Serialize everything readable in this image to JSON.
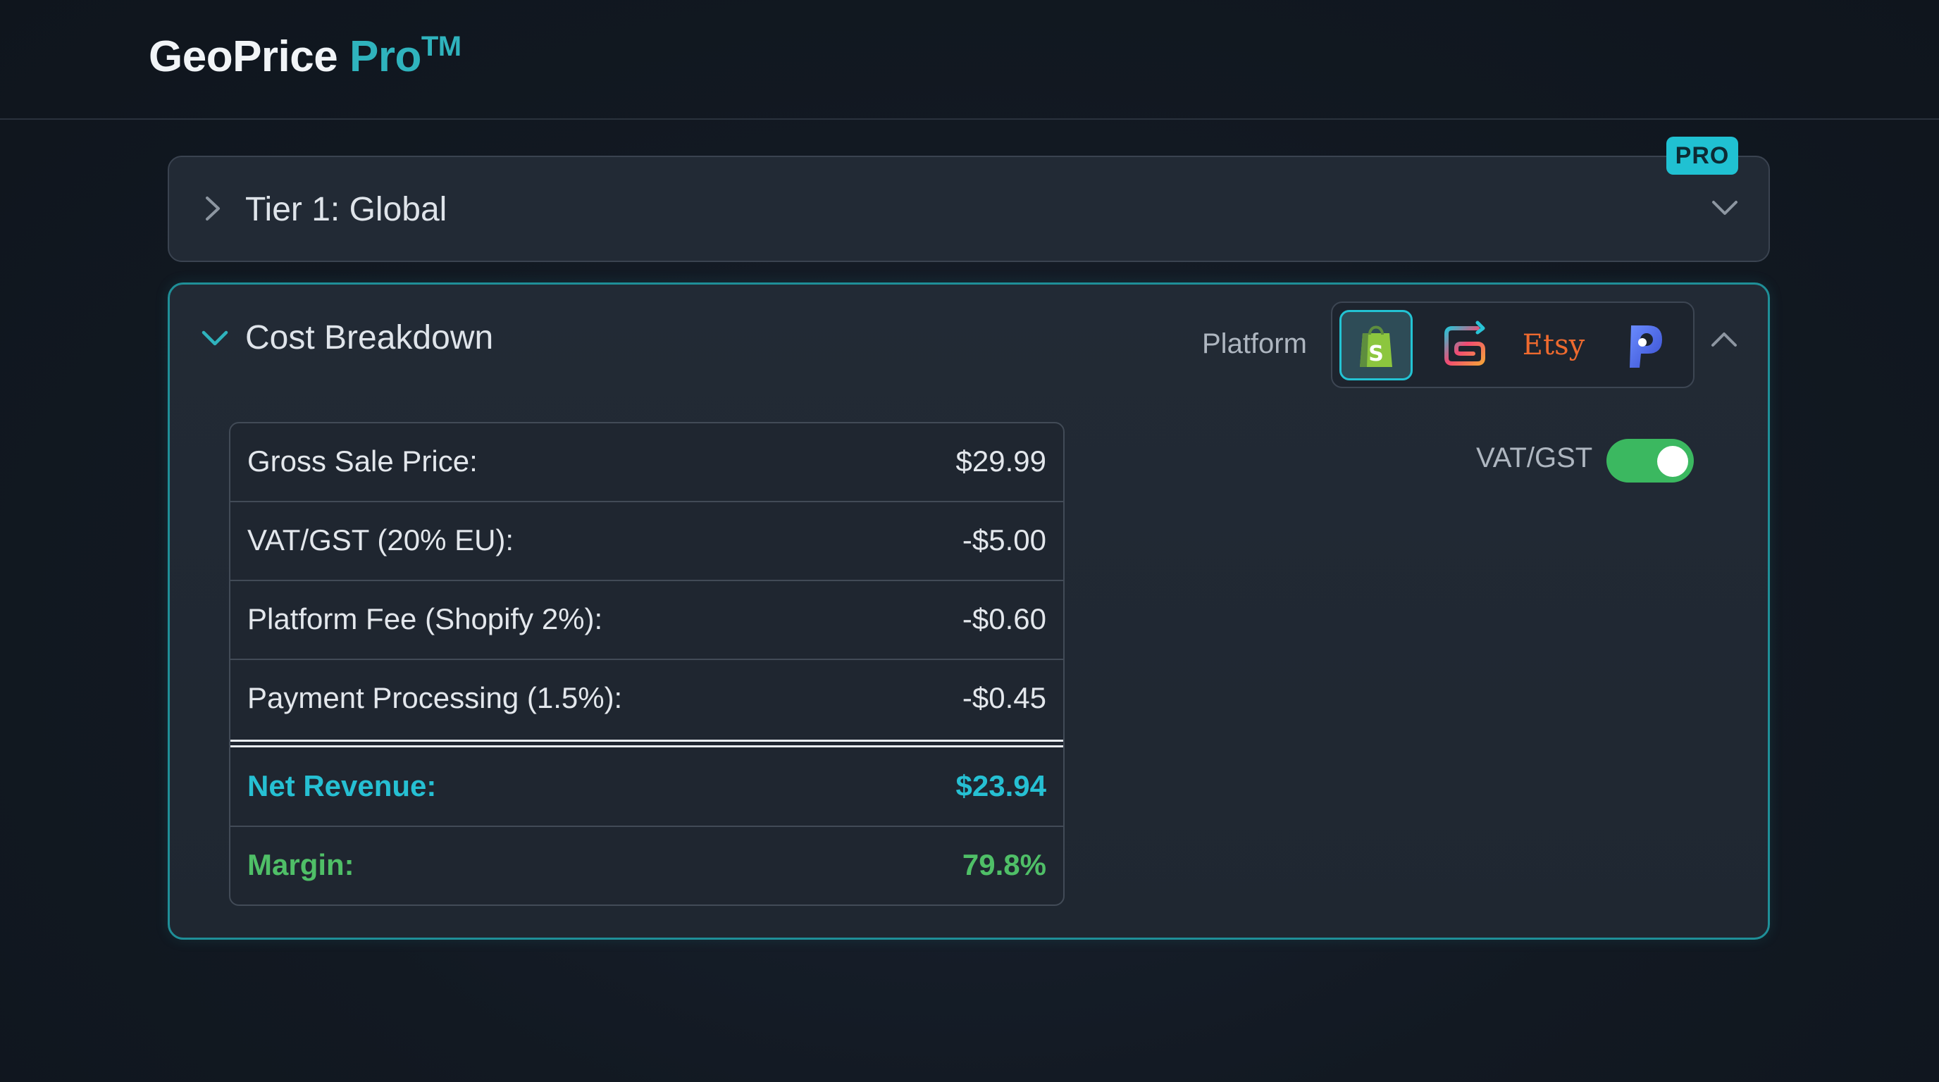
{
  "app": {
    "brand_main": "GeoPrice",
    "brand_accent": "Pro",
    "brand_tm": "TM"
  },
  "tier": {
    "title": "Tier 1: Global",
    "badge": "PRO"
  },
  "cost": {
    "title": "Cost Breakdown",
    "platform_label": "Platform",
    "platforms": [
      {
        "name": "shopify",
        "icon": "shopify-bag-icon",
        "selected": true
      },
      {
        "name": "square-spiral",
        "icon": "spiral-logo-icon",
        "selected": false
      },
      {
        "name": "etsy",
        "label": "Etsy",
        "selected": false
      },
      {
        "name": "p-logo",
        "icon": "p-logo-icon",
        "selected": false
      }
    ],
    "vat_label": "VAT/GST",
    "vat_enabled": true,
    "rows": [
      {
        "label": "Gross Sale Price:",
        "value": "$29.99"
      },
      {
        "label": "VAT/GST (20% EU):",
        "value": "-$5.00"
      },
      {
        "label": "Platform Fee (Shopify 2%):",
        "value": "-$0.60"
      },
      {
        "label": "Payment Processing (1.5%):",
        "value": "-$0.45"
      }
    ],
    "net_revenue": {
      "label": "Net Revenue:",
      "value": "$23.94"
    },
    "margin": {
      "label": "Margin:",
      "value": "79.8%"
    }
  },
  "colors": {
    "accent_teal": "#2fb3bd",
    "badge_cyan": "#20c1d2",
    "net_cyan": "#26c0d3",
    "margin_green": "#4fbf67",
    "toggle_green": "#3bb860",
    "etsy_orange": "#ee6a2f"
  }
}
